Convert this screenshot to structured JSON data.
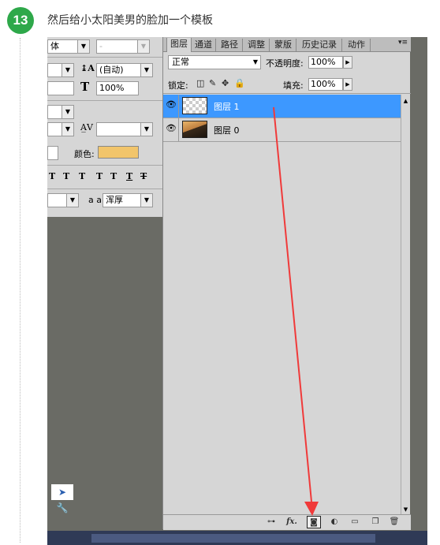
{
  "step": {
    "number": "13",
    "title": "然后给小太阳美男的脸加一个模板"
  },
  "char_panel": {
    "font_style": "体",
    "font_style_disabled_value": "-",
    "leading_value": "(自动)",
    "vertical_scale": "100%",
    "color_label": "颜色:",
    "color_value": "#f2c56b",
    "type_style_buttons": [
      "T",
      "T",
      "T",
      "T",
      "T",
      "T",
      "T"
    ],
    "aa_label": "a a",
    "aa_value": "浑厚"
  },
  "layers_panel": {
    "tabs": [
      "图层",
      "通道",
      "路径",
      "调整",
      "蒙版",
      "历史记录",
      "动作"
    ],
    "menu_glyph": "▾≡",
    "blend_mode": "正常",
    "opacity_label": "不透明度:",
    "opacity_value": "100%",
    "lock_label": "锁定:",
    "fill_label": "填充:",
    "fill_value": "100%",
    "layers": [
      {
        "name": "图层 1",
        "selected": true,
        "thumbnail": "transparent"
      },
      {
        "name": "图层 0",
        "selected": false,
        "thumbnail": "photo"
      }
    ],
    "bottom_buttons": [
      "link-layers-icon",
      "fx",
      "add-mask-icon",
      "adjustment-icon",
      "group-folder-icon",
      "new-layer-icon",
      "trash-icon"
    ],
    "fx_label": "fx."
  },
  "colors": {
    "selection": "#3d98ff",
    "annotation_arrow": "#f03a3a",
    "step_badge": "#2ea84a"
  }
}
